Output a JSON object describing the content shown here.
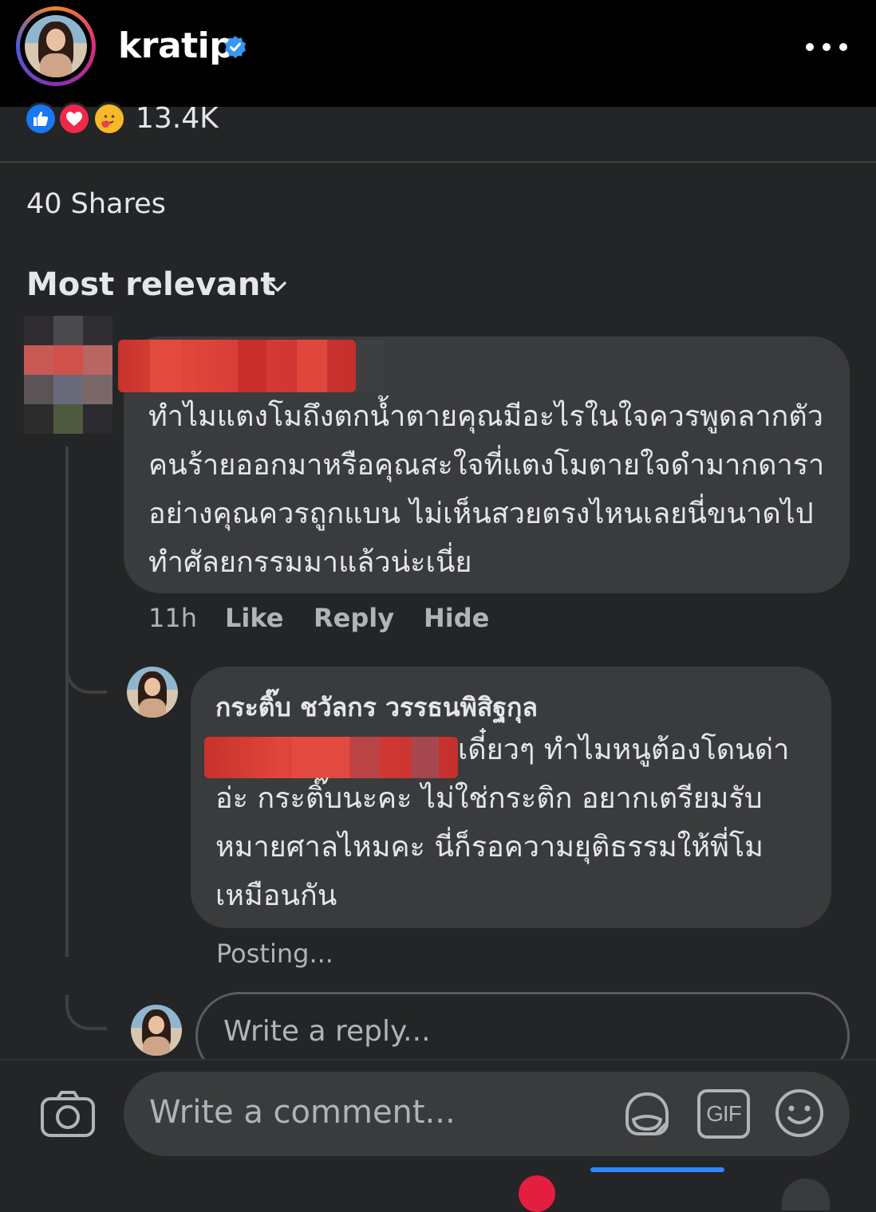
{
  "header": {
    "username": "kratip",
    "verified_icon": "verified-badge-icon",
    "more_icon": "more-horizontal-icon"
  },
  "reactions": {
    "icons": [
      "like-icon",
      "love-icon",
      "care-icon"
    ],
    "count": "13.4K"
  },
  "shares": "40 Shares",
  "sort": {
    "label": "Most relevant",
    "icon": "chevron-down-icon"
  },
  "comments": [
    {
      "author_redacted": true,
      "text": "ทำไมแตงโมถึงตกน้ำตายคุณมีอะไรในใจควรพูดลากตัวคนร้ายออกมาหรือคุณสะใจที่แตงโมตายใจดำมากดาราอย่างคุณควรถูกแบน ไม่เห็นสวยตรงไหนเลยนี่ขนาดไปทำศัลยกรรมมาแล้วน่ะเนี่ย",
      "time": "11h",
      "actions": [
        "Like",
        "Reply",
        "Hide"
      ],
      "replies": [
        {
          "author": "กระติ๊บ ชวัลกร วรรธนพิสิฐกุล",
          "text": "เดี๋ยวๆ ทำไมหนูต้องโดนด่า อ่ะ กระติ๊บนะคะ ไม่ใช่กระติก อยากเตรียมรับหมายศาลไหมคะ นี่ก็รอความยุติธรรมให้พี่โมเหมือนกัน",
          "status": "Posting..."
        }
      ]
    }
  ],
  "reply_input": {
    "placeholder": "Write a reply..."
  },
  "composer": {
    "placeholder": "Write a comment...",
    "icons": [
      "camera-icon",
      "sticker-icon",
      "gif-icon",
      "emoji-icon"
    ],
    "gif_label": "GIF"
  },
  "colors": {
    "background": "#242526",
    "bubble": "#3a3b3c",
    "text": "#e4e6eb",
    "secondary_text": "#b0b3b8",
    "accent": "#1877f2",
    "redaction": "#d63a35"
  }
}
